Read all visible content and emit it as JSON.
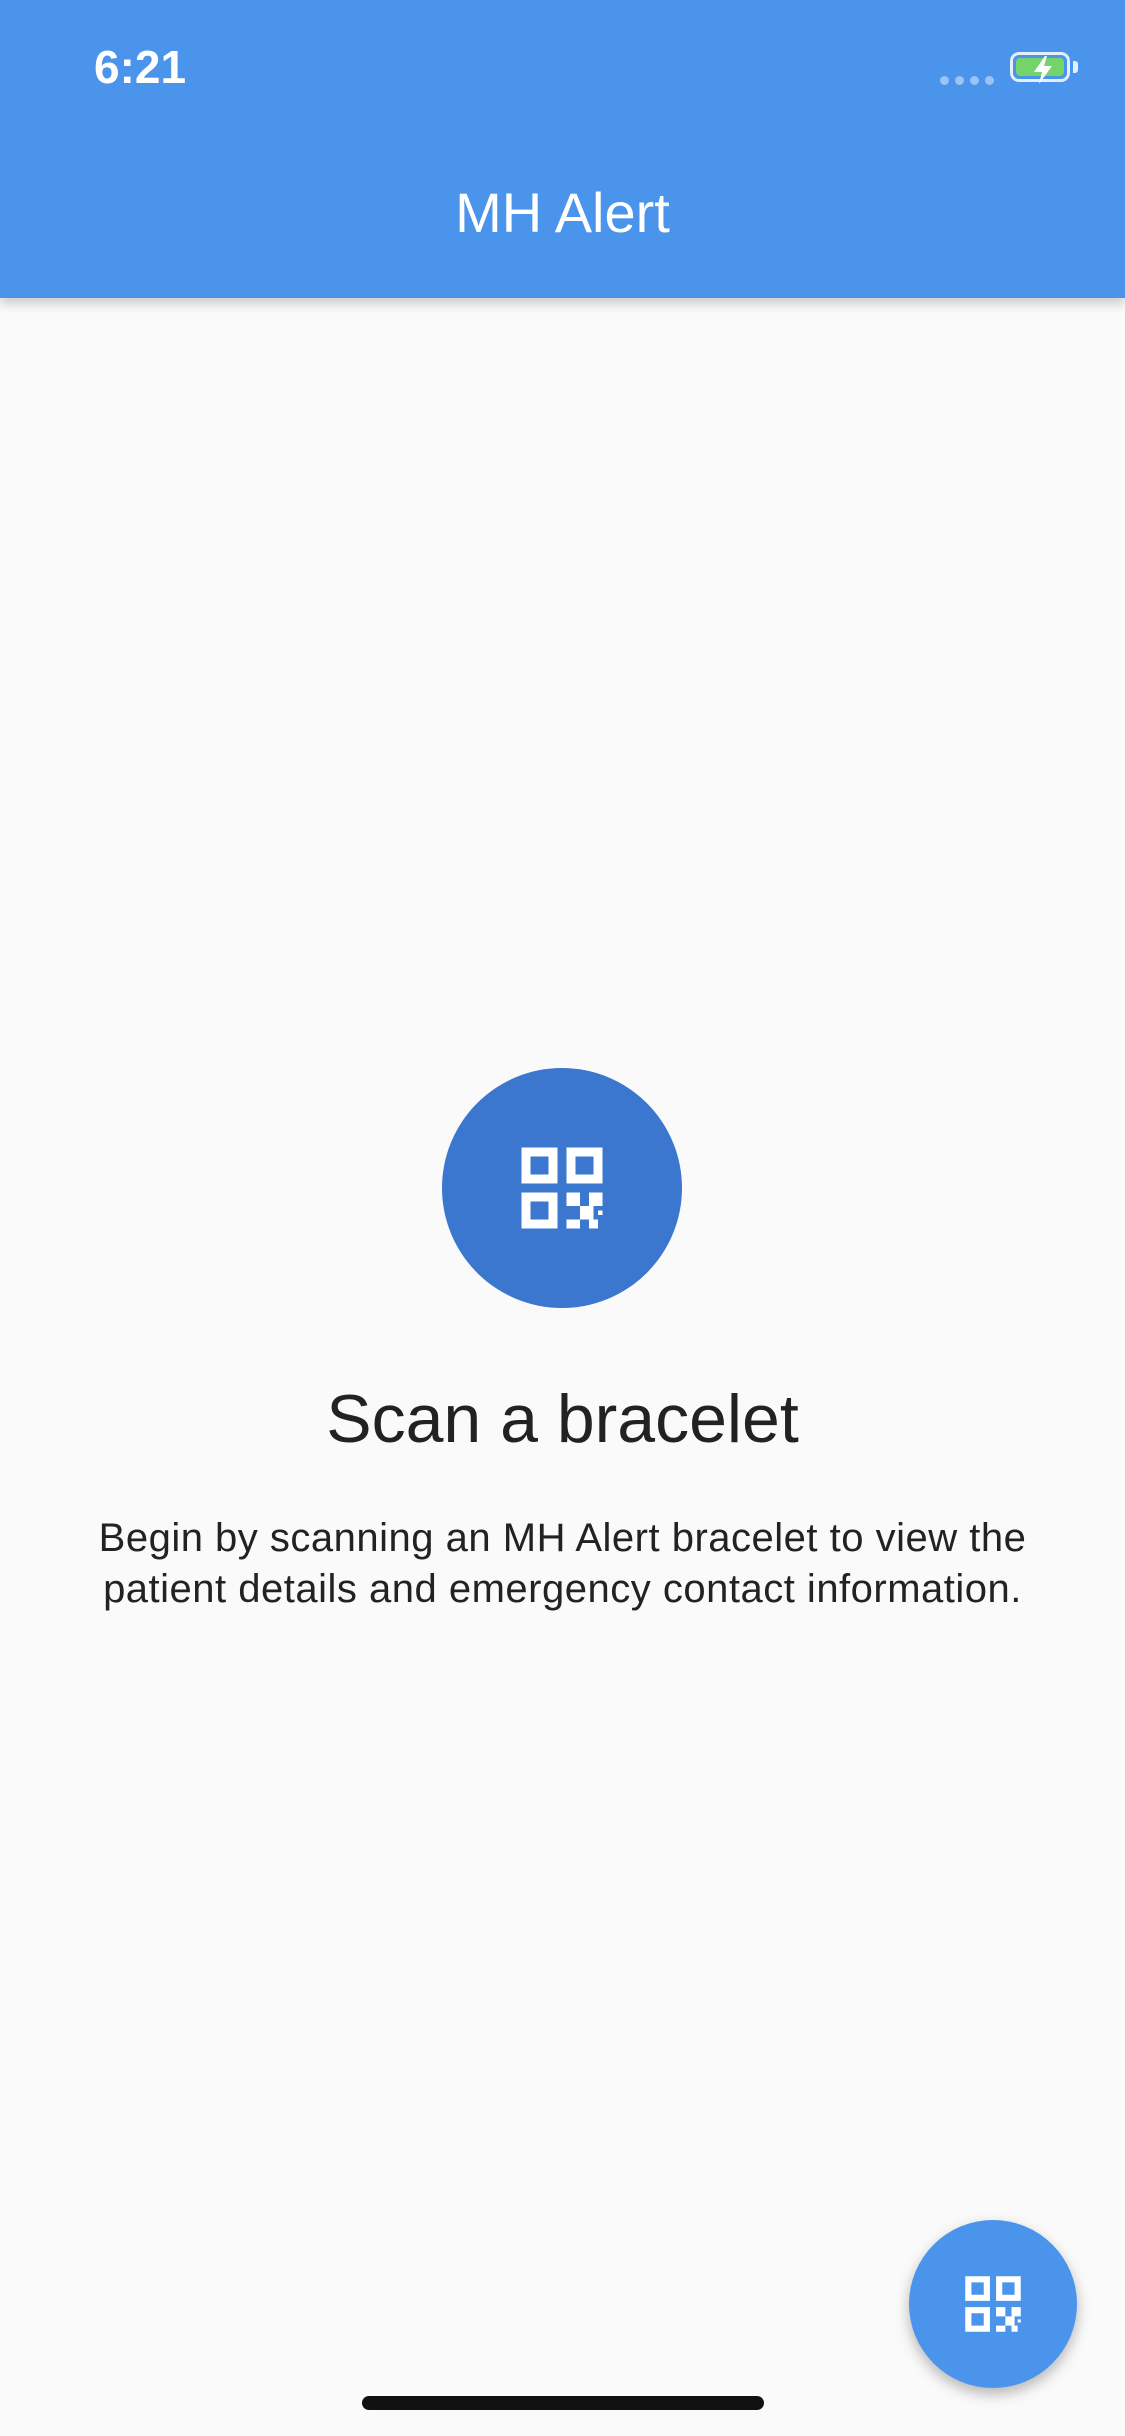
{
  "status_bar": {
    "time": "6:21"
  },
  "app_bar": {
    "title": "MH Alert"
  },
  "empty_state": {
    "icon": "qr-code-icon",
    "title": "Scan a bracelet",
    "description": "Begin by scanning an MH Alert bracelet to view the patient details and emergency contact information."
  },
  "fab": {
    "icon": "qr-code-icon"
  },
  "colors": {
    "primary": "#4a94eb",
    "icon_circle": "#3b76cf",
    "background": "#fafafa",
    "battery": "#74d46a"
  }
}
